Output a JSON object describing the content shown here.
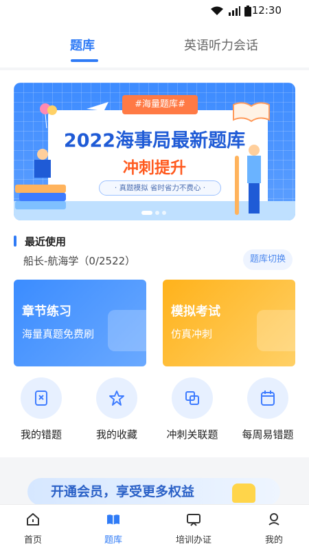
{
  "status": {
    "time": "12:30"
  },
  "top_tabs": [
    {
      "label": "题库",
      "active": true
    },
    {
      "label": "英语听力会话",
      "active": false
    }
  ],
  "banner": {
    "tag": "#海量题库#",
    "title": "2022海事局最新题库",
    "subtitle": "冲刺提升",
    "pill": "· 真题模拟  省时省力不费心 ·",
    "dots": 3,
    "active_dot": 0,
    "colors": {
      "bg": "#3d8bff",
      "title": "#1f5bd6",
      "subtitle": "#ff5a1f",
      "tag": "#ff7a45"
    }
  },
  "recent": {
    "title": "最近使用",
    "course": "船长-航海学（0/2522）",
    "switch_label": "题库切换"
  },
  "cards": [
    {
      "title": "章节练习",
      "subtitle": "海量真题免费刷",
      "color": "blue",
      "icon": "book-icon"
    },
    {
      "title": "模拟考试",
      "subtitle": "仿真冲刺",
      "color": "yellow",
      "icon": "score-100-icon"
    }
  ],
  "quick_actions": [
    {
      "label": "我的错题",
      "icon": "wrong-questions-icon"
    },
    {
      "label": "我的收藏",
      "icon": "star-icon"
    },
    {
      "label": "冲刺关联题",
      "icon": "linked-questions-icon"
    },
    {
      "label": "每周易错题",
      "icon": "calendar-icon"
    }
  ],
  "promo": {
    "text": "开通会员，享受更多权益"
  },
  "bottom_nav": [
    {
      "label": "首页",
      "icon": "home-icon",
      "active": false
    },
    {
      "label": "题库",
      "icon": "question-bank-icon",
      "active": true
    },
    {
      "label": "培训办证",
      "icon": "training-icon",
      "active": false
    },
    {
      "label": "我的",
      "icon": "profile-icon",
      "active": false
    }
  ],
  "accent": "#2f7bf6"
}
